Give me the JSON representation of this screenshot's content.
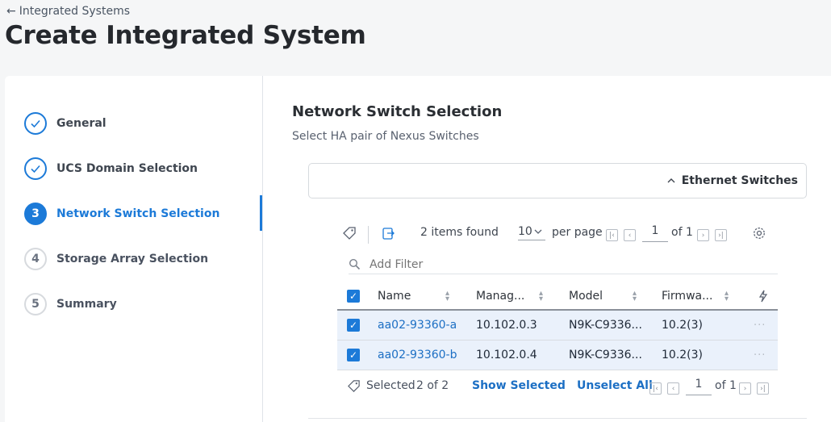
{
  "breadcrumb": {
    "label": "Integrated Systems"
  },
  "page_title": "Create Integrated System",
  "steps": [
    {
      "number": "",
      "label": "General",
      "state": "done"
    },
    {
      "number": "",
      "label": "UCS Domain Selection",
      "state": "done"
    },
    {
      "number": "3",
      "label": "Network Switch Selection",
      "state": "active"
    },
    {
      "number": "4",
      "label": "Storage Array Selection",
      "state": "todo"
    },
    {
      "number": "5",
      "label": "Summary",
      "state": "todo"
    }
  ],
  "section": {
    "title": "Network Switch Selection",
    "subtitle": "Select HA pair of Nexus Switches"
  },
  "ethernet_panel": {
    "label": "Ethernet Switches"
  },
  "toolbar": {
    "items_found": "2 items found",
    "per_page_value": "10",
    "per_page_label": "per page",
    "page": "1",
    "of_pages": "of 1"
  },
  "filter": {
    "placeholder": "Add Filter"
  },
  "table": {
    "columns": [
      "Name",
      "Manag...",
      "Model",
      "Firmwa..."
    ],
    "rows": [
      {
        "name": "aa02-93360-a",
        "management": "10.102.0.3",
        "model": "N9K-C9336...",
        "firmware": "10.2(3)"
      },
      {
        "name": "aa02-93360-b",
        "management": "10.102.0.4",
        "model": "N9K-C9336...",
        "firmware": "10.2(3)"
      }
    ]
  },
  "footer": {
    "selected_label": "Selected",
    "selected_count": "2 of 2",
    "show_selected": "Show Selected",
    "unselect_all": "Unselect All",
    "page": "1",
    "of_pages": "of 1"
  },
  "colors": {
    "accent": "#1c7ad8",
    "link": "#1c6fc4",
    "selected_row": "#eaf1fb"
  }
}
